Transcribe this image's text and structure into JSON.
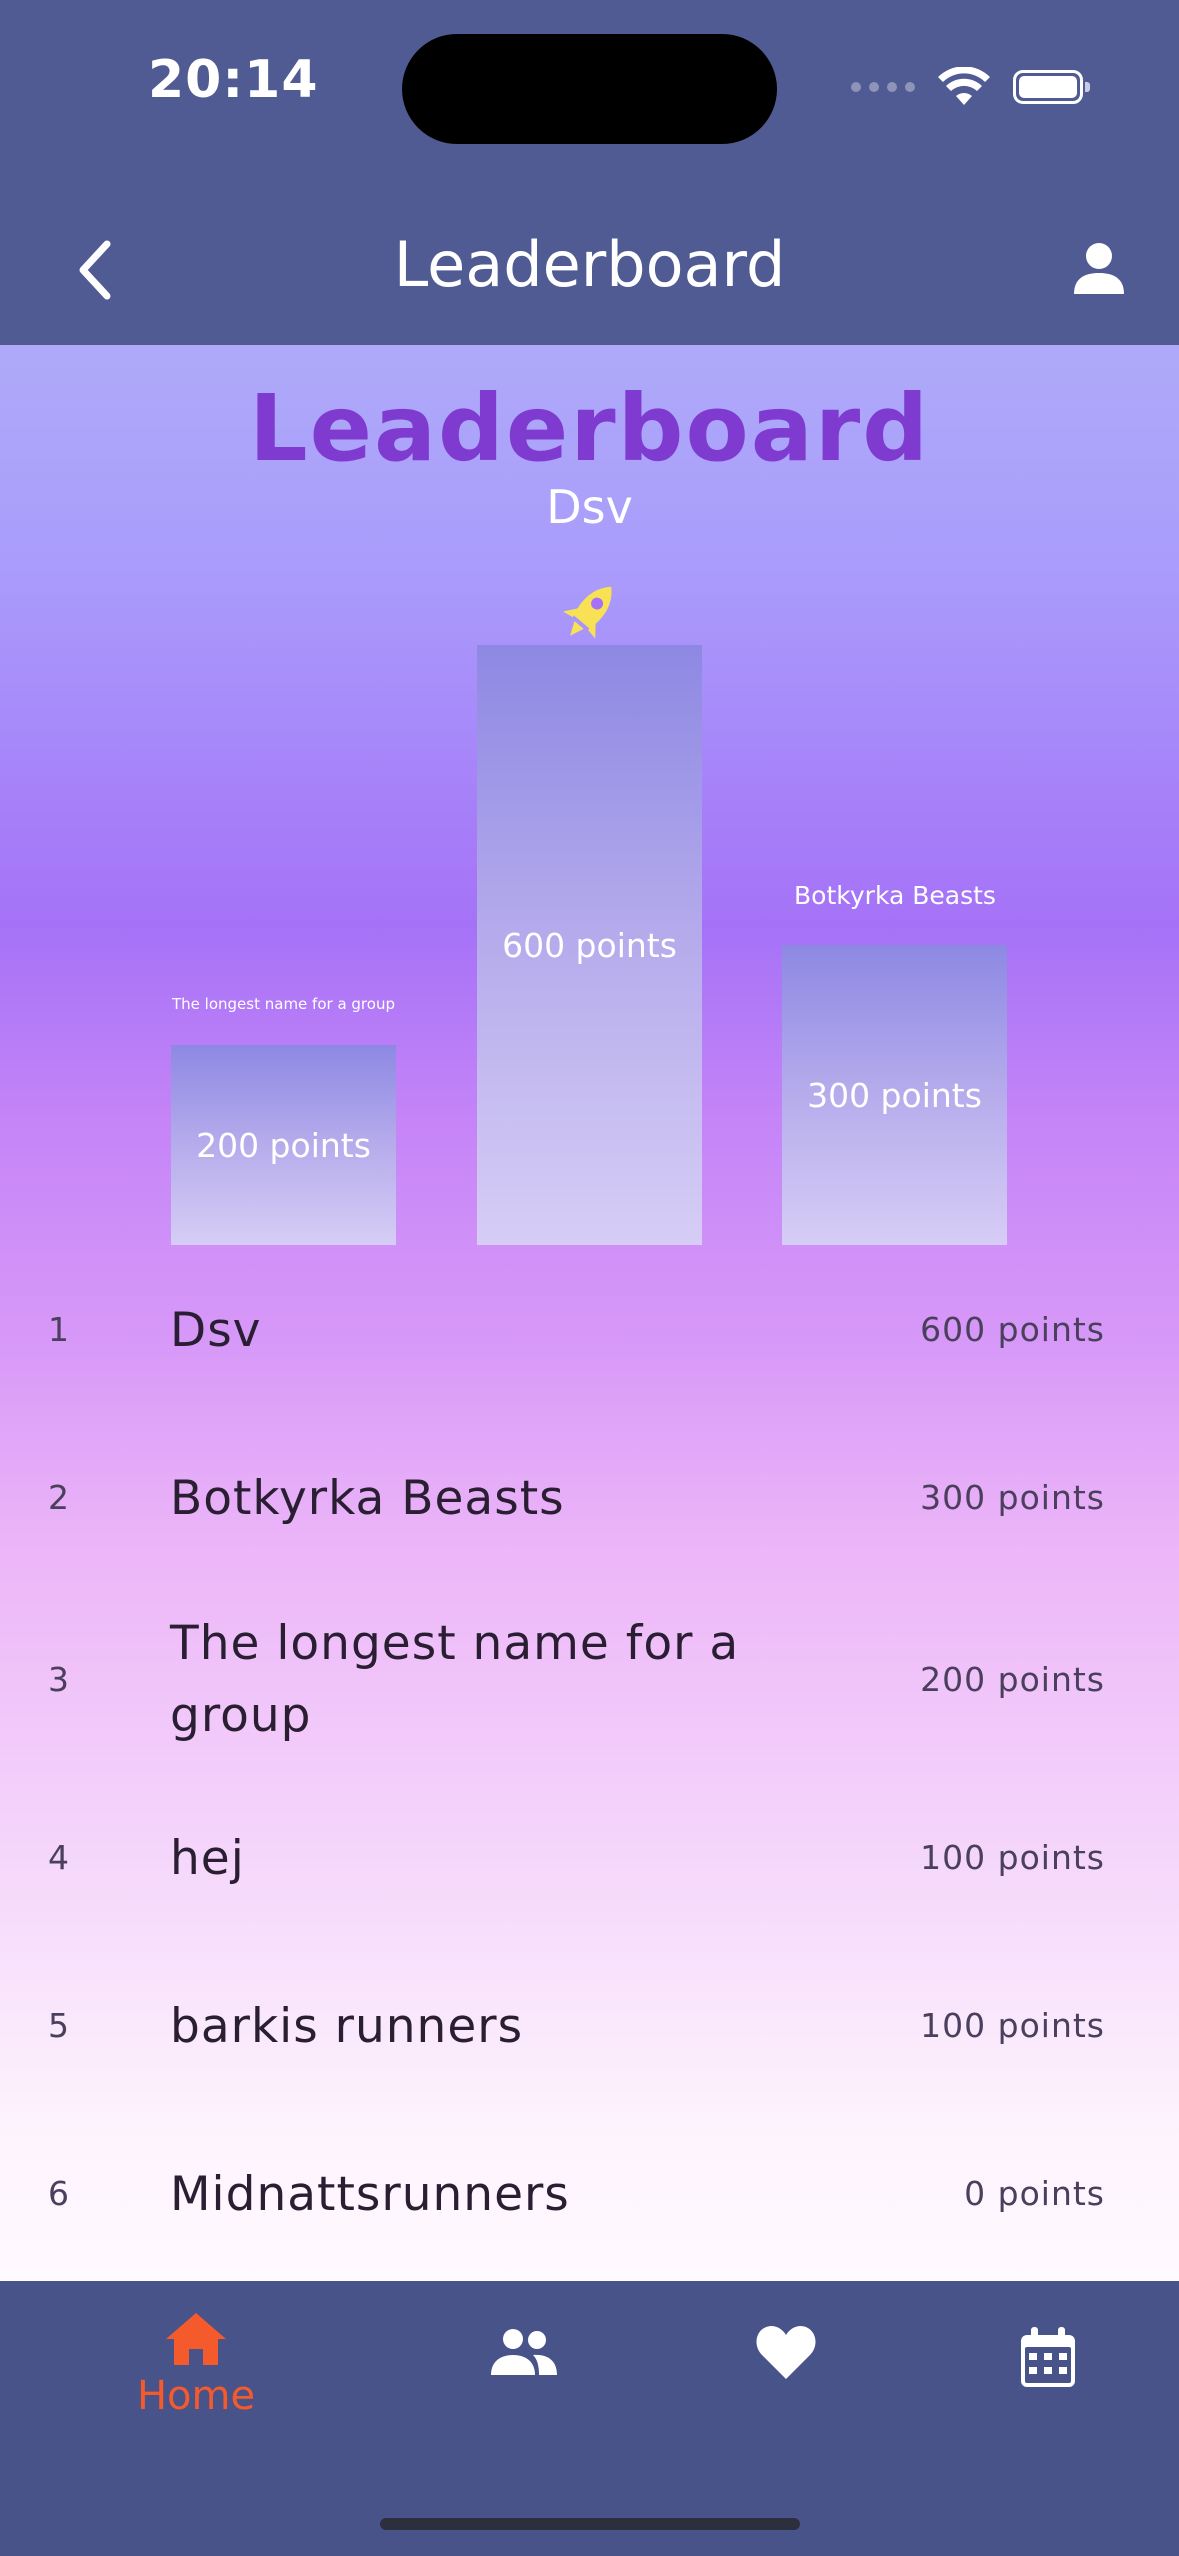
{
  "status": {
    "time": "20:14"
  },
  "nav": {
    "title": "Leaderboard"
  },
  "header": {
    "title": "Leaderboard",
    "subtitle": "Dsv"
  },
  "podium": {
    "first": {
      "name": "",
      "points": "600 points"
    },
    "second": {
      "name": "The longest name for a group",
      "points": "200 points"
    },
    "third": {
      "name": "Botkyrka Beasts",
      "points": "300 points"
    }
  },
  "rows": [
    {
      "rank": "1",
      "name": "Dsv",
      "points": "600 points"
    },
    {
      "rank": "2",
      "name": "Botkyrka Beasts",
      "points": "300 points"
    },
    {
      "rank": "3",
      "name": "The longest name for a group",
      "points": "200 points"
    },
    {
      "rank": "4",
      "name": "hej",
      "points": "100 points"
    },
    {
      "rank": "5",
      "name": "barkis runners",
      "points": "100 points"
    },
    {
      "rank": "6",
      "name": "Midnattsrunners",
      "points": "0 points"
    }
  ],
  "tabs": [
    {
      "label": "Home",
      "icon": "home-icon",
      "active": true
    },
    {
      "label": "",
      "icon": "group-icon",
      "active": false
    },
    {
      "label": "",
      "icon": "heart-icon",
      "active": false
    },
    {
      "label": "",
      "icon": "calendar-icon",
      "active": false
    }
  ],
  "colors": {
    "nav": "#4f5b92",
    "tabbar": "#48538a",
    "title": "#7f3bd0",
    "active_tab": "#f45a2c",
    "rocket": "#f9e155"
  }
}
